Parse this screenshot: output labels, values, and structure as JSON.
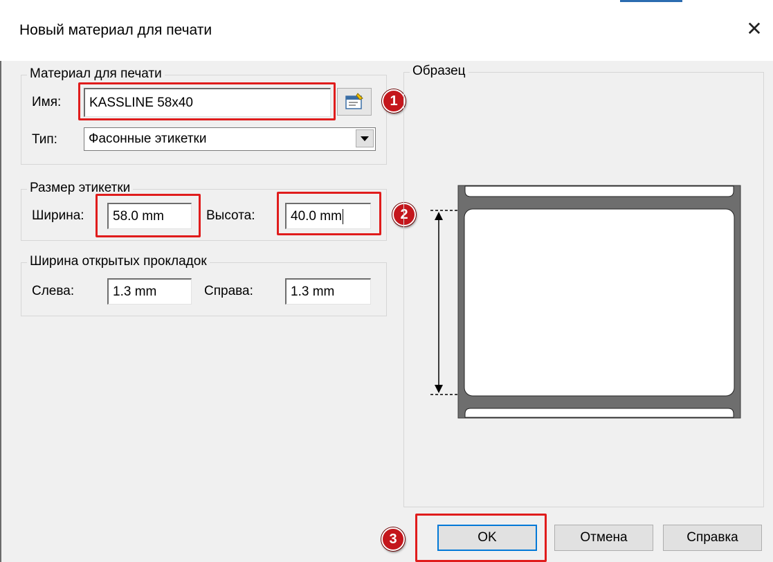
{
  "dialog": {
    "title": "Новый материал для печати",
    "close_symbol": "✕"
  },
  "media_group": {
    "legend": "Материал для печати",
    "name_label": "Имя:",
    "name_value": "KASSLINE  58x40",
    "type_label": "Тип:",
    "type_value": "Фасонные этикетки"
  },
  "size_group": {
    "legend": "Размер этикетки",
    "width_label": "Ширина:",
    "width_value": "58.0 mm",
    "height_label": "Высота:",
    "height_value": "40.0 mm"
  },
  "gap_group": {
    "legend": "Ширина открытых прокладок",
    "left_label": "Слева:",
    "left_value": "1.3 mm",
    "right_label": "Справа:",
    "right_value": "1.3 mm"
  },
  "preview": {
    "legend": "Образец"
  },
  "buttons": {
    "ok": "OK",
    "cancel": "Отмена",
    "help": "Справка"
  },
  "annotations": {
    "step1": "1",
    "step2": "2",
    "step3": "3"
  },
  "colors": {
    "highlight": "#e01c1c",
    "badge": "#c4161c",
    "liner": "#6e6e6e"
  },
  "icons": {
    "browse": "properties-icon",
    "dropdown": "chevron-down-icon",
    "close": "close-icon"
  }
}
